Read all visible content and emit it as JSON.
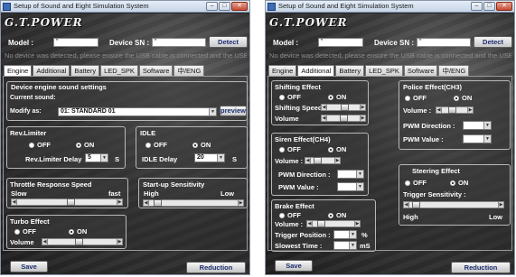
{
  "window": {
    "title": "Setup of Sound and Eight Simulation System",
    "brand": "G.T.POWER",
    "minimize_glyph": "–",
    "maximize_glyph": "□",
    "close_glyph": "✕"
  },
  "header": {
    "model_label": "Model :",
    "model_value": "\"",
    "device_sn_label": "Device SN :",
    "device_sn_value": "\"",
    "detect_button": "Detect",
    "no_device_text": "No device was detected, please ensure the USB cable is connected and the USB mode"
  },
  "tabs": [
    "Engine",
    "Additional",
    "Battery",
    "LED_SPK",
    "Software",
    "中/ENG"
  ],
  "left": {
    "active_tab": "Engine",
    "engine_sound": {
      "title": "Device engine sound settings",
      "current_sound_label": "Current sound:",
      "modify_label": "Modify as:",
      "modify_value": "01: STANDARD 01",
      "preview_button": "preview"
    },
    "rev_limiter": {
      "title": "Rev.Limiter",
      "off_label": "OFF",
      "on_label": "ON",
      "selected": "ON",
      "delay_label": "Rev.Limiter Delay",
      "delay_value": "5",
      "delay_unit": "S"
    },
    "idle": {
      "title": "IDLE",
      "off_label": "OFF",
      "on_label": "ON",
      "selected": "ON",
      "delay_label": "IDLE Delay",
      "delay_value": "20",
      "delay_unit": "S"
    },
    "throttle": {
      "title": "Throttle Response Speed",
      "slow_label": "Slow",
      "fast_label": "fast",
      "level": 0.55
    },
    "startup": {
      "title": "Start-up Sensitivity",
      "high_label": "High",
      "low_label": "Low",
      "level": 0.05
    },
    "turbo": {
      "title": "Turbo Effect",
      "off_label": "OFF",
      "on_label": "ON",
      "selected": "ON",
      "volume_label": "Volume",
      "volume_level": 0.45
    },
    "save_button": "Save",
    "reduction_button": "Reduction"
  },
  "right": {
    "active_tab": "Additional",
    "shifting": {
      "title": "Shifting Effect",
      "off_label": "OFF",
      "on_label": "ON",
      "selected": "ON",
      "speed_label": "Shifting Speed",
      "speed_level": 0.55,
      "volume_label": "Volume",
      "volume_level": 0.5
    },
    "police": {
      "title": "Police Effect(CH3)",
      "off_label": "OFF",
      "on_label": "ON",
      "selected": "ON",
      "volume_label": "Volume :",
      "volume_level": 0.35,
      "pwm_dir_label": "PWM Direction :",
      "pwm_val_label": "PWM Value :"
    },
    "siren": {
      "title": "Siren Effect(CH4)",
      "off_label": "OFF",
      "on_label": "ON",
      "selected": "ON",
      "volume_label": "Volume :",
      "volume_level": 0.1,
      "pwm_dir_label": "PWM Direction :",
      "pwm_val_label": "PWM Value :"
    },
    "steering": {
      "title": "Steering Effect",
      "off_label": "OFF",
      "on_label": "ON",
      "selected": "ON",
      "trigger_label": "Trigger Sensitivity :",
      "high_label": "High",
      "low_label": "Low",
      "level": 0.02
    },
    "brake": {
      "title": "Brake Effect",
      "off_label": "OFF",
      "on_label": "ON",
      "selected": "ON",
      "volume_label": "Volume :",
      "volume_level": 0.1,
      "trigger_pos_label": "Trigger Position :",
      "trigger_pos_unit": "%",
      "slowest_label": "Slowest Time :",
      "slowest_unit": "mS"
    },
    "save_button": "Save",
    "reduction_button": "Reduction"
  }
}
